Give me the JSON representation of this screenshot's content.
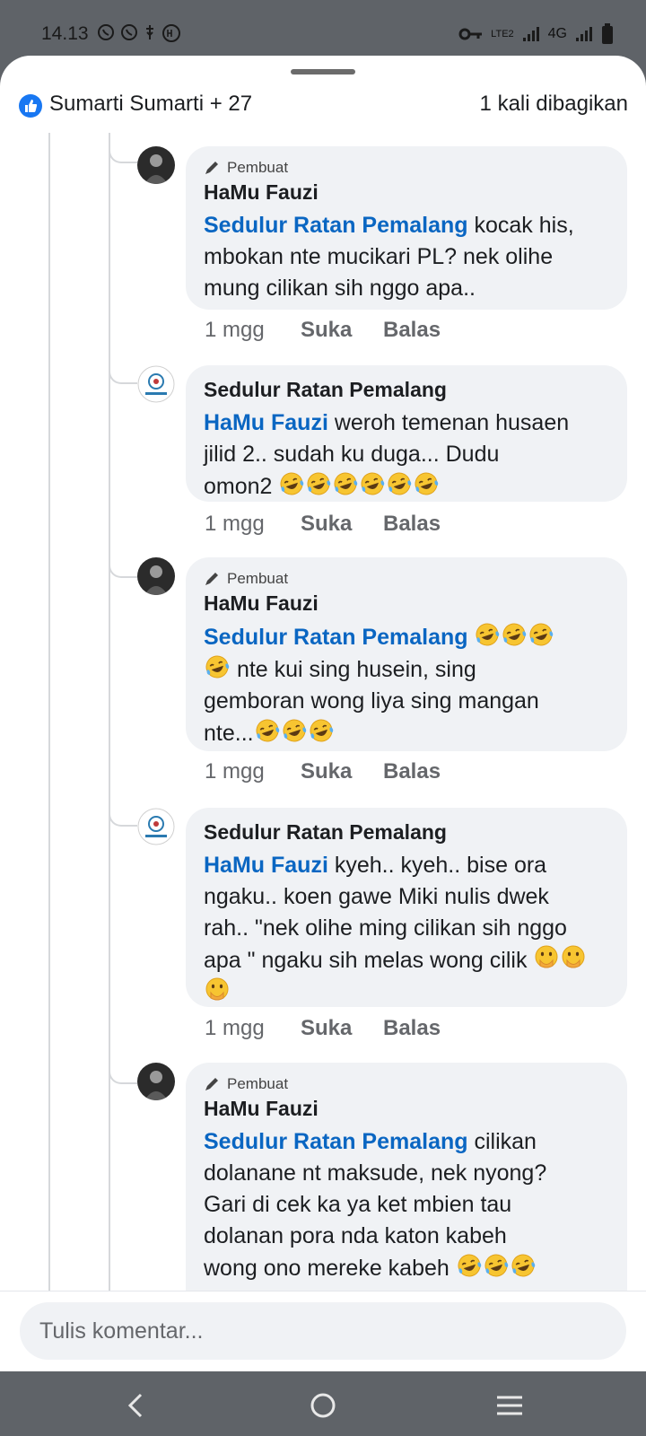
{
  "status_bar": {
    "time": "14.13",
    "network_label": "4G",
    "lte_label": "LTE2"
  },
  "header": {
    "reactions": "Sumarti Sumarti + 27",
    "shares": "1 kali dibagikan"
  },
  "comments": [
    {
      "badge": "Pembuat",
      "author": "HaMu Fauzi",
      "mention": "Sedulur Ratan Pemalang",
      "lines": [
        " kocak his,",
        "mbokan nte mucikari PL? nek olihe",
        "mung cilikan sih nggo apa.."
      ],
      "time_ago": "1 mgg",
      "like": "Suka",
      "reply": "Balas"
    },
    {
      "author": "Sedulur Ratan Pemalang",
      "mention": "HaMu Fauzi",
      "lines": [
        " weroh temenan husaen",
        "jilid 2.. sudah ku duga... Dudu",
        "omon2 "
      ],
      "time_ago": "1 mgg",
      "like": "Suka",
      "reply": "Balas"
    },
    {
      "badge": "Pembuat",
      "author": "HaMu Fauzi",
      "mention": "Sedulur Ratan Pemalang",
      "lines": [
        " nte kui sing husein, sing",
        "gemboran wong liya sing mangan",
        "nte..."
      ],
      "time_ago": "1 mgg",
      "like": "Suka",
      "reply": "Balas"
    },
    {
      "author": "Sedulur Ratan Pemalang",
      "mention": "HaMu Fauzi",
      "lines": [
        " kyeh.. kyeh.. bise ora",
        "ngaku.. koen gawe Miki nulis dwek",
        "rah.. \"nek olihe ming cilikan sih nggo",
        "apa \" ngaku sih melas wong cilik "
      ],
      "time_ago": "1 mgg",
      "like": "Suka",
      "reply": "Balas"
    },
    {
      "badge": "Pembuat",
      "author": "HaMu Fauzi",
      "mention": "Sedulur Ratan Pemalang",
      "lines": [
        " cilikan",
        "dolanane nt maksude, nek nyong?",
        "Gari di cek ka ya ket mbien tau",
        "dolanan pora nda katon kabeh",
        "wong ono mereke kabeh "
      ]
    }
  ],
  "composer": {
    "placeholder": "Tulis komentar..."
  },
  "colors": {
    "accent": "#0a66c2",
    "like_blue": "#1877f2",
    "bubble": "#f0f2f5",
    "meta_grey": "#65676b"
  }
}
